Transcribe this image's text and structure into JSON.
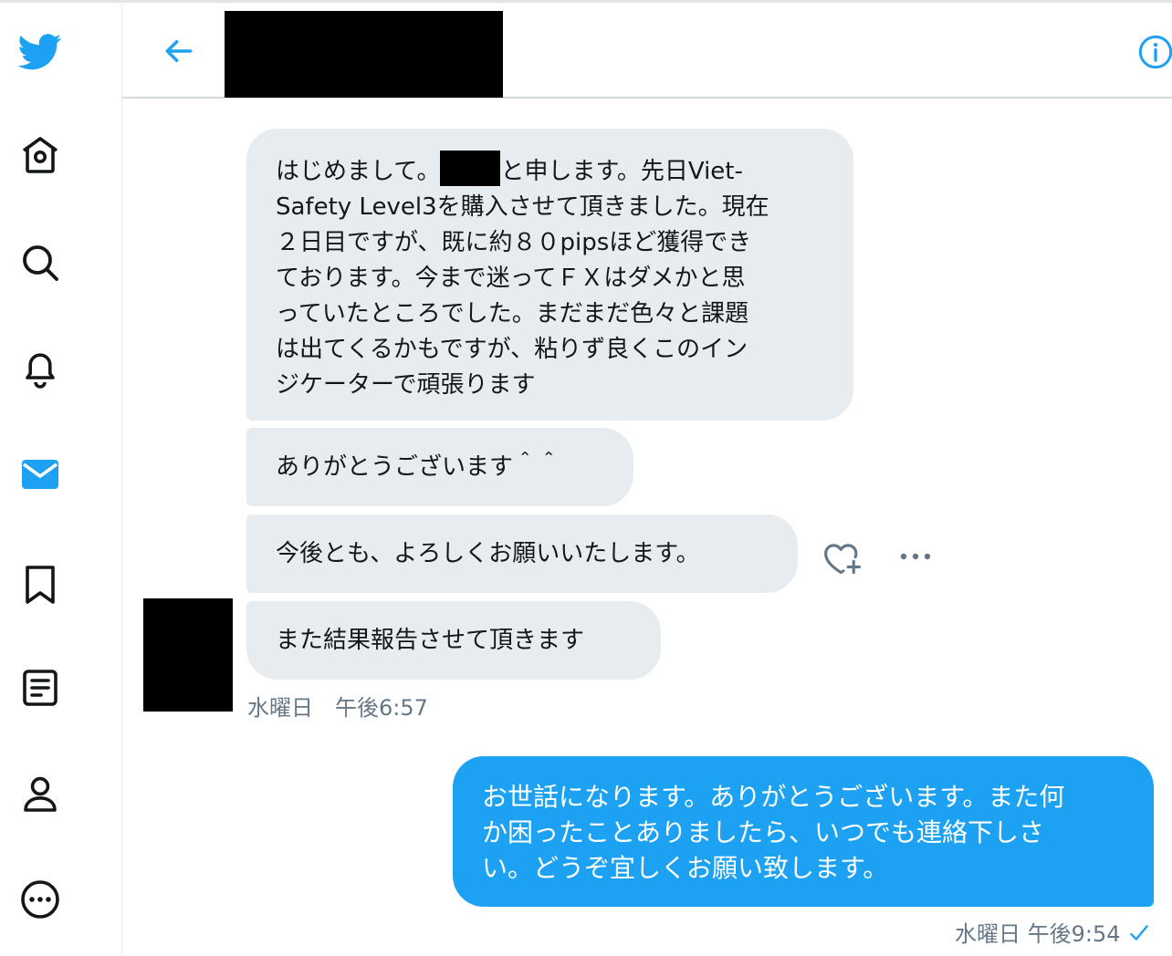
{
  "header": {
    "back_label": "←"
  },
  "messages": {
    "m1_a": "はじめまして。",
    "m1_b": "と申します。先日Viet-",
    "m1_c": "Safety Level3を購入させて頂きました。現在",
    "m1_d": "２日目ですが、既に約８０pipsほど獲得でき",
    "m1_e": "ております。今まで迷ってＦＸはダメかと思",
    "m1_f": "っていたところでした。まだまだ色々と課題",
    "m1_g": "は出てくるかもですが、粘りず良くこのイン",
    "m1_h": "ジケーターで頑張ります",
    "m2": "ありがとうございます＾＾",
    "m3": "今後とも、よろしくお願いいたします。",
    "m4": "また結果報告させて頂きます",
    "received_time": "水曜日　午後6:57",
    "sent_a": "お世話になります。ありがとうございます。また何",
    "sent_b": "か困ったことありましたら、いつでも連絡下しさ",
    "sent_c": "い。どうぞ宜しくお願い致します。",
    "sent_time": "水曜日 午後9:54"
  },
  "icons": [
    "twitter-logo-icon",
    "home-icon",
    "search-icon",
    "bell-icon",
    "mail-icon",
    "bookmark-icon",
    "list-icon",
    "profile-icon",
    "more-icon",
    "back-arrow-icon",
    "info-icon",
    "heart-plus-icon",
    "more-horizontal-icon",
    "check-icon"
  ],
  "colors": {
    "accent": "#1da1f2",
    "bubble_gray": "#e6ecf0",
    "muted": "#657786"
  }
}
